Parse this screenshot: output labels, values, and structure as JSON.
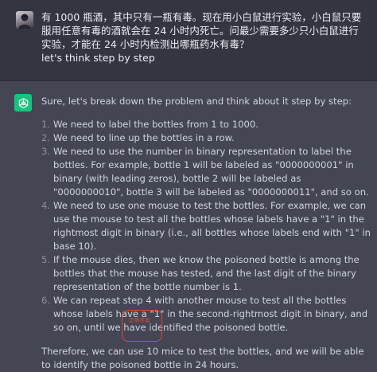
{
  "user_message": {
    "line1": "有 1000 瓶酒，其中只有一瓶有毒。现在用小白鼠进行实验，小白鼠只要服用任意有毒的酒就会在 24 小时内死亡。问最少需要多少只小白鼠进行实验，才能在 24 小时内检测出哪瓶药水有毒？",
    "line2": "let's think step by step"
  },
  "assistant_message": {
    "intro": "Sure, let's break down the problem and think about it step by step:",
    "steps": [
      {
        "num": "1.",
        "text": "We need to label the bottles from 1 to 1000."
      },
      {
        "num": "2.",
        "text": "We need to line up the bottles in a row."
      },
      {
        "num": "3.",
        "text": "We need to use the number in binary representation to label the bottles. For example, bottle 1 will be labeled as \"0000000001\" in binary (with leading zeros), bottle 2 will be labeled as \"0000000010\", bottle 3 will be labeled as \"0000000011\", and so on."
      },
      {
        "num": "4.",
        "text": "We need to use one mouse to test the bottles. For example, we can use the mouse to test all the bottles whose labels have a \"1\" in the rightmost digit in binary (i.e., all bottles whose labels end with \"1\" in base 10)."
      },
      {
        "num": "5.",
        "text": "If the mouse dies, then we know the poisoned bottle is among the bottles that the mouse has tested, and the last digit of the binary representation of the bottle number is 1."
      },
      {
        "num": "6.",
        "text": "We can repeat step 4 with another mouse to test all the bottles whose labels have a \"1\" in the second-rightmost digit in binary, and so on, until we have identified the poisoned bottle."
      }
    ],
    "conclusion": "Therefore, we can use 10 mice to test the bottles, and we will be able to identify the poisoned bottle in 24 hours."
  },
  "annotation": {
    "label": "正确答案",
    "color": "#e2463b"
  },
  "icons": {
    "user": "user-avatar-icon",
    "assistant": "openai-logo-icon"
  },
  "colors": {
    "user_bg": "#343541",
    "assistant_bg": "#444654",
    "openai_green": "#19c37d"
  }
}
